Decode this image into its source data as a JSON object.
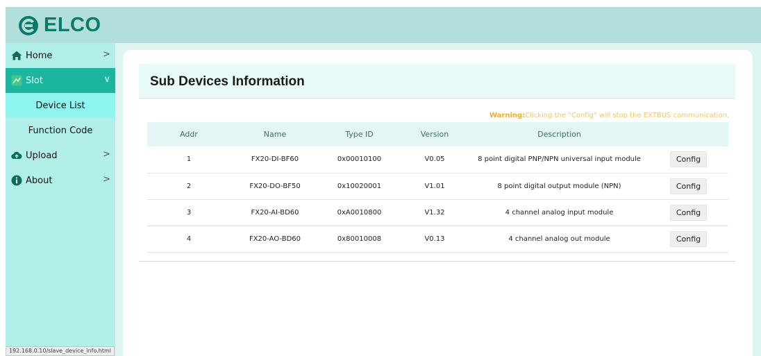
{
  "brand": {
    "name": "ELCO"
  },
  "sidebar": {
    "items": [
      {
        "label": "Home",
        "icon": "home-icon",
        "arrow": ">"
      },
      {
        "label": "Slot",
        "icon": "slot-icon",
        "arrow": "∨"
      },
      {
        "label": "Upload",
        "icon": "upload-icon",
        "arrow": ">"
      },
      {
        "label": "About",
        "icon": "info-icon",
        "arrow": ">"
      }
    ],
    "subitems": [
      {
        "label": "Device List"
      },
      {
        "label": "Function Code"
      }
    ]
  },
  "main": {
    "title": "Sub Devices Information",
    "warning": {
      "prefix": "Warning:",
      "text": "Clicking the \"Config\" will stop the EXTBUS communication."
    },
    "table": {
      "headers": [
        "Addr",
        "Name",
        "Type ID",
        "Version",
        "Description",
        ""
      ],
      "rows": [
        {
          "addr": "1",
          "name": "FX20-DI-BF60",
          "type_id": "0x00010100",
          "version": "V0.05",
          "description": "8 point digital PNP/NPN universal input module",
          "action": "Config"
        },
        {
          "addr": "2",
          "name": "FX20-DO-BF50",
          "type_id": "0x10020001",
          "version": "V1.01",
          "description": "8 point digital output module (NPN)",
          "action": "Config"
        },
        {
          "addr": "3",
          "name": "FX20-AI-BD60",
          "type_id": "0xA0010800",
          "version": "V1.32",
          "description": "4 channel analog input module",
          "action": "Config"
        },
        {
          "addr": "4",
          "name": "FX20-AO-BD60",
          "type_id": "0x80010008",
          "version": "V0.13",
          "description": "4 channel analog out module",
          "action": "Config"
        }
      ]
    }
  },
  "statusbar": {
    "url": "192.168.0.10/slave_device_info.html"
  },
  "colors": {
    "header_bg": "#b2dfdb",
    "sidebar_bg": "#b2efe9",
    "active_bg": "#1bb5a0",
    "selected_sub_bg": "#8ef6ee",
    "brand_green": "#0c7a6b",
    "warning": "#eeae2d"
  }
}
